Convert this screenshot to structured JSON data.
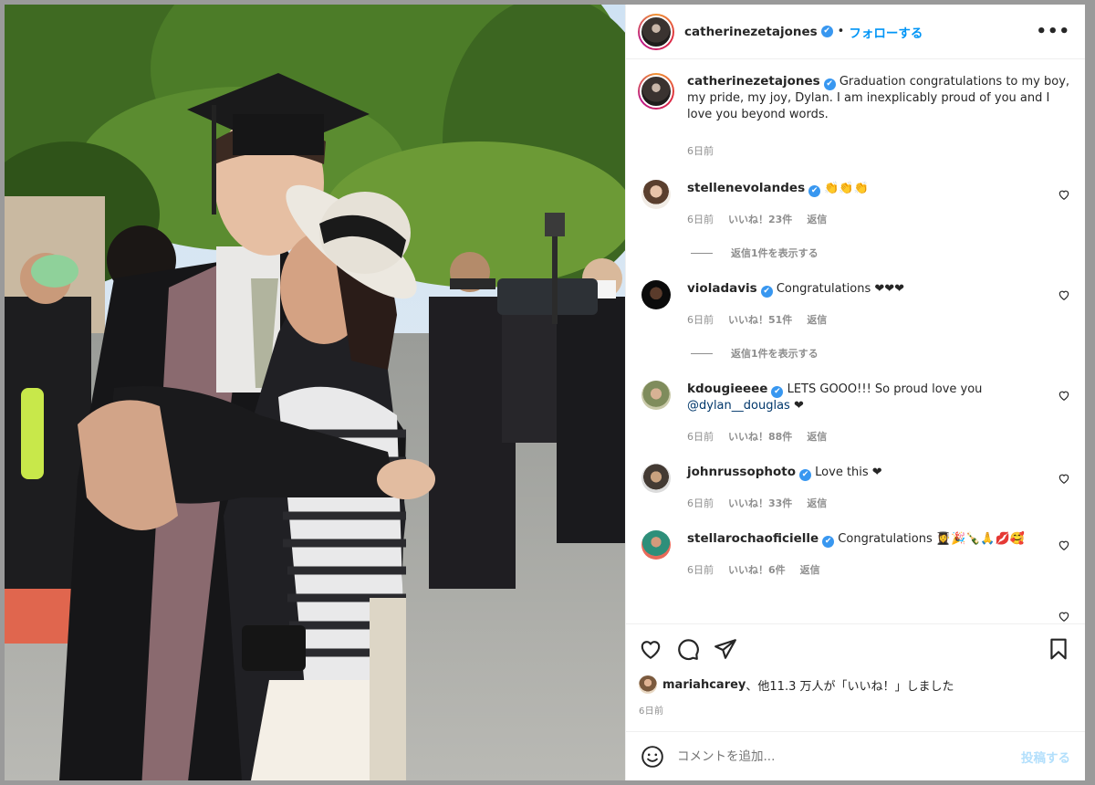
{
  "post": {
    "username": "catherinezetajones",
    "verified_mark": "✔",
    "separator": "•",
    "follow_label": "フォローする",
    "more_label": "•••",
    "caption": "Graduation congratulations to my boy, my pride, my joy, Dylan. I am inexplicably proud of you and I love you beyond words.",
    "caption_time": "6日前",
    "comments": [
      {
        "user": "stellenevolandes",
        "text": "👏👏👏",
        "time": "6日前",
        "likes": "いいね！23件",
        "reply": "返信",
        "view_replies": "返信1件を表示する",
        "avatar_color": "#d9c7b5"
      },
      {
        "user": "violadavis",
        "text": "Congratulations ❤❤❤",
        "time": "6日前",
        "likes": "いいね！51件",
        "reply": "返信",
        "view_replies": "返信1件を表示する",
        "avatar_color": "#1a1a1a"
      },
      {
        "user": "kdougieeee",
        "text_before": "LETS GOOO!!! So proud love you ",
        "mention": "@dylan__douglas",
        "text_after": " ❤",
        "time": "6日前",
        "likes": "いいね！88件",
        "reply": "返信",
        "avatar_color": "#a7b08a"
      },
      {
        "user": "johnrussophoto",
        "text": "Love this ❤",
        "time": "6日前",
        "likes": "いいね！33件",
        "reply": "返信",
        "avatar_color": "#8b7b6a"
      },
      {
        "user": "stellarochaoficielle",
        "text": "Congratulations 👩‍🎓🎉🍾🙏💋🥰",
        "time": "6日前",
        "likes": "いいね！6件",
        "reply": "返信",
        "avatar_color": "#2e8f7a"
      }
    ],
    "likes_user": "mariahcarey",
    "likes_text": "、他11.3 万人が「いいね！」しました",
    "date": "6日前",
    "add_comment_placeholder": "コメントを追加...",
    "post_button": "投稿する"
  },
  "icons": {
    "heart": "heart-icon",
    "comment": "comment-icon",
    "share": "share-icon",
    "save": "bookmark-icon",
    "emoji": "emoji-icon",
    "more": "more-icon"
  },
  "colors": {
    "link_blue": "#0095f6",
    "verified_blue": "#3897f0",
    "muted": "#8e8e8e",
    "post_disabled": "#b2dffc"
  }
}
